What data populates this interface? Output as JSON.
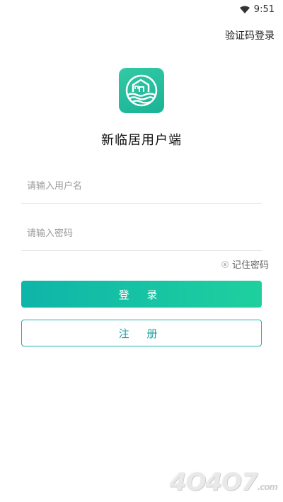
{
  "status_bar": {
    "time": "9:51",
    "icon": "wifi-icon"
  },
  "header": {
    "sms_login_link": "验证码登录"
  },
  "logo": {
    "icon": "house-logo-icon",
    "color": "#22bf9e"
  },
  "app": {
    "title": "新临居用户端"
  },
  "form": {
    "username_placeholder": "请输入用户名",
    "username_value": "",
    "password_placeholder": "请输入密码",
    "password_value": "",
    "remember_label": "记住密码",
    "remember_checked": false
  },
  "buttons": {
    "login_label": "登 录",
    "register_label": "注 册",
    "accent_start": "#0eb5a9",
    "accent_end": "#1fd09e"
  },
  "watermark": {
    "text": "4O4O7",
    "suffix": ".com"
  }
}
